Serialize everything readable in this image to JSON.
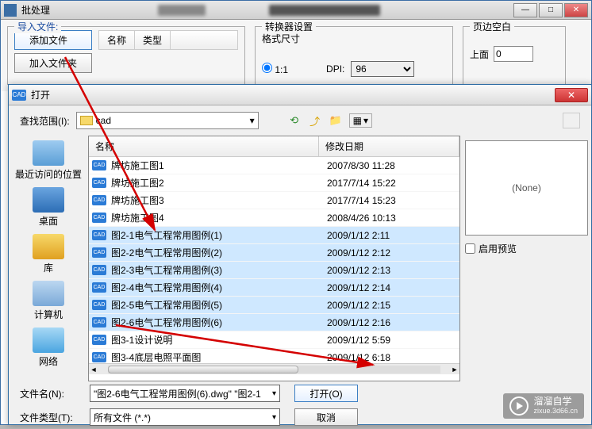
{
  "mainWindow": {
    "title": "批处理",
    "importLegend": "导入文件:",
    "addFileBtn": "添加文件",
    "addFolderBtn": "加入文件夹",
    "colName": "名称",
    "colType": "类型",
    "converterLegend": "转换器设置",
    "formatLabel": "格式尺寸",
    "ratioLabel": "1:1",
    "dpiLabel": "DPI:",
    "dpiValue": "96",
    "marginLegend": "页边空白",
    "topLabel": "上面",
    "topValue": "0"
  },
  "dialog": {
    "title": "打开",
    "lookInLabel": "查找范围(I):",
    "folderName": "cad",
    "colName": "名称",
    "colDate": "修改日期",
    "previewNone": "(None)",
    "enablePreview": "启用预览",
    "fileNameLabel": "文件名(N):",
    "fileNameValue": "\"图2-6电气工程常用图例(6).dwg\" \"图2-1",
    "fileTypeLabel": "文件类型(T):",
    "fileTypeValue": "所有文件 (*.*)",
    "openBtn": "打开(O)",
    "cancelBtn": "取消",
    "places": {
      "recent": "最近访问的位置",
      "desktop": "桌面",
      "library": "库",
      "computer": "计算机",
      "network": "网络"
    },
    "files": [
      {
        "name": "牌坊施工图1",
        "date": "2007/8/30 11:28",
        "sel": false
      },
      {
        "name": "牌坊施工图2",
        "date": "2017/7/14 15:22",
        "sel": false
      },
      {
        "name": "牌坊施工图3",
        "date": "2017/7/14 15:23",
        "sel": false
      },
      {
        "name": "牌坊施工图4",
        "date": "2008/4/26 10:13",
        "sel": false
      },
      {
        "name": "图2-1电气工程常用图例(1)",
        "date": "2009/1/12 2:11",
        "sel": true
      },
      {
        "name": "图2-2电气工程常用图例(2)",
        "date": "2009/1/12 2:12",
        "sel": true
      },
      {
        "name": "图2-3电气工程常用图例(3)",
        "date": "2009/1/12 2:13",
        "sel": true
      },
      {
        "name": "图2-4电气工程常用图例(4)",
        "date": "2009/1/12 2:14",
        "sel": true
      },
      {
        "name": "图2-5电气工程常用图例(5)",
        "date": "2009/1/12 2:15",
        "sel": true
      },
      {
        "name": "图2-6电气工程常用图例(6)",
        "date": "2009/1/12 2:16",
        "sel": true
      },
      {
        "name": "图3-1设计说明",
        "date": "2009/1/12 5:59",
        "sel": false
      },
      {
        "name": "图3-4底层电照平面图",
        "date": "2009/1/12 6:18",
        "sel": false
      }
    ]
  },
  "watermark": {
    "brand": "溜溜自学",
    "url": "zixue.3d66.cn"
  }
}
